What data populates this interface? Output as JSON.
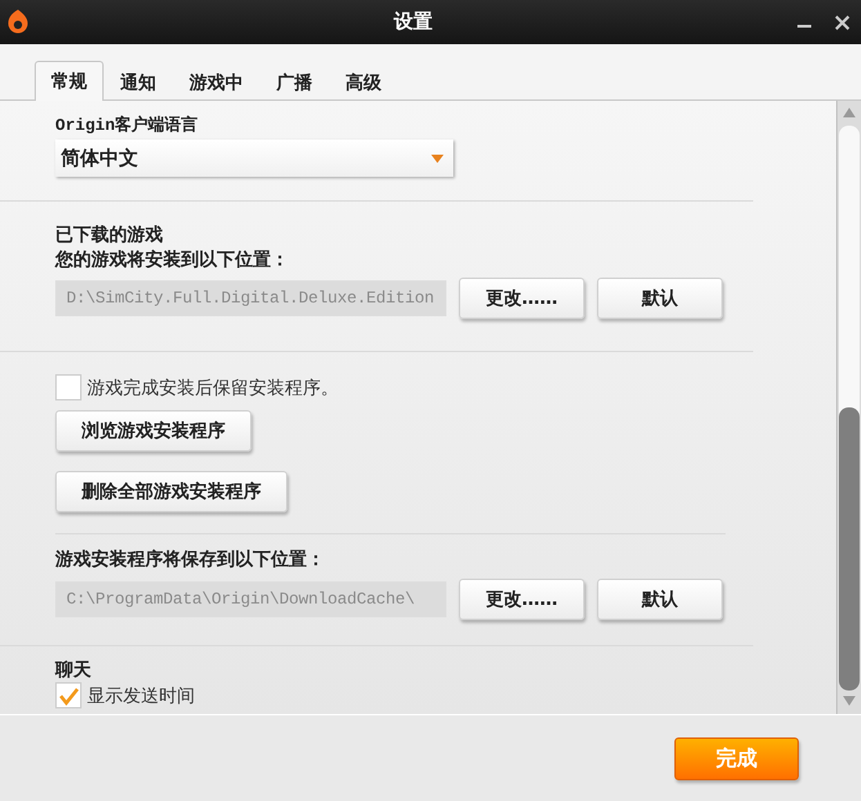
{
  "window": {
    "title": "设置"
  },
  "tabs": [
    {
      "label": "常规",
      "selected": true
    },
    {
      "label": "通知",
      "selected": false
    },
    {
      "label": "游戏中",
      "selected": false
    },
    {
      "label": "广播",
      "selected": false
    },
    {
      "label": "高级",
      "selected": false
    }
  ],
  "language": {
    "label": "Origin客户端语言",
    "value": "简体中文"
  },
  "downloaded_games": {
    "heading": "已下载的游戏",
    "label": "您的游戏将安装到以下位置：",
    "path": "D:\\SimCity.Full.Digital.Deluxe.Edition",
    "buttons": [
      "更改……",
      "默认"
    ]
  },
  "installers": {
    "keep": {
      "label": "游戏完成安装后保留安装程序。",
      "checked": false
    },
    "buttons": [
      "浏览游戏安装程序",
      "删除全部游戏安装程序"
    ],
    "label": "游戏安装程序将保存到以下位置：",
    "path": "C:\\ProgramData\\Origin\\DownloadCache\\",
    "path_buttons": [
      "更改……",
      "默认"
    ]
  },
  "chat": {
    "heading": "聊天",
    "show_time": {
      "label": "显示发送时间",
      "checked": true
    }
  },
  "footer": {
    "done": "完成"
  }
}
